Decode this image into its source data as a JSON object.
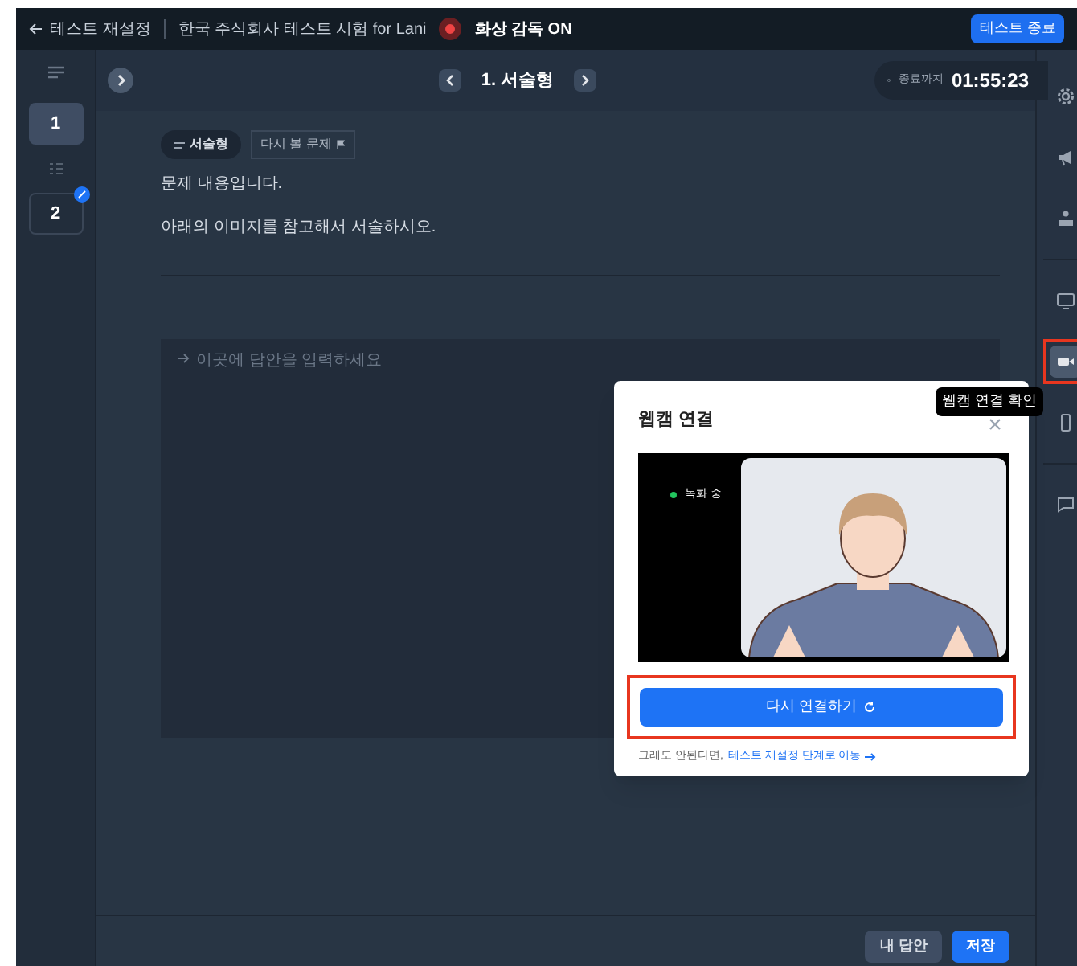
{
  "top_bar": {
    "back": "테스트 재설정",
    "test_name": "한국 주식회사 테스트 시험 for Lani",
    "proctoring": {
      "label": "화상 감독 ON",
      "on": true
    },
    "end_button": "테스트 종료"
  },
  "question_nav": {
    "title": "1. 서술형",
    "timer_label": "종료까지",
    "timer": "01:55:23"
  },
  "questions": [
    {
      "number": "1",
      "selected": true,
      "answered": false
    },
    {
      "number": "2",
      "selected": false,
      "answered": true
    }
  ],
  "question": {
    "type_tag": "서술형",
    "review_tag": "다시 볼 문제",
    "lines": [
      "문제 내용입니다.",
      "아래의 이미지를 참고해서 서술하시오."
    ]
  },
  "answer": {
    "placeholder": "이곳에 답안을 입력하세요"
  },
  "footer_buttons": [
    {
      "label": "내 답안",
      "kind": "secondary"
    },
    {
      "label": "저장",
      "kind": "primary"
    }
  ],
  "right_tools": [
    {
      "kind": "settings",
      "selected": false,
      "highlighted": false
    },
    {
      "kind": "announce",
      "selected": false,
      "highlighted": false
    },
    {
      "kind": "support",
      "selected": false,
      "highlighted": false
    },
    {
      "kind": "screen",
      "selected": false,
      "highlighted": false
    },
    {
      "kind": "webcam",
      "selected": true,
      "highlighted": true
    },
    {
      "kind": "mobile",
      "selected": false,
      "highlighted": false
    },
    {
      "kind": "chat",
      "selected": false,
      "highlighted": false
    }
  ],
  "tooltip": "웹캠 연결 확인",
  "webcam_dialog": {
    "title": "웹캠 연결",
    "recording": "녹화 중",
    "button": "다시 연결하기",
    "button_highlighted": true,
    "help": "그래도 안된다면,",
    "help_link": "테스트 재설정 단계로 이동"
  }
}
